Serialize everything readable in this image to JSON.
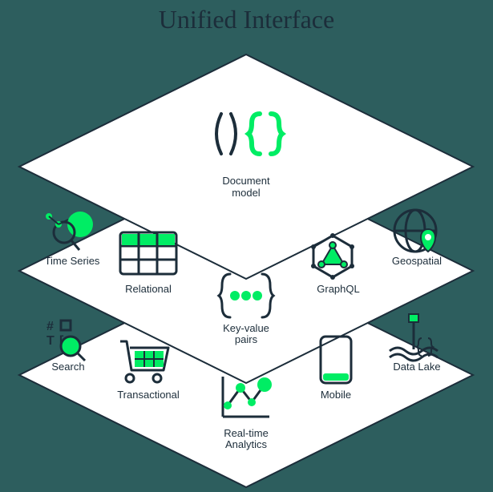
{
  "title": "Unified Interface",
  "layers": {
    "top": {
      "items": [
        {
          "label": "Document model",
          "icon": "document-model-icon"
        }
      ]
    },
    "middle": {
      "items": [
        {
          "label": "Time Series",
          "icon": "time-series-icon"
        },
        {
          "label": "Relational",
          "icon": "relational-icon"
        },
        {
          "label": "Key-value pairs",
          "icon": "key-value-icon"
        },
        {
          "label": "GraphQL",
          "icon": "graphql-icon"
        },
        {
          "label": "Geospatial",
          "icon": "geospatial-icon"
        }
      ]
    },
    "bottom": {
      "items": [
        {
          "label": "Search",
          "icon": "search-icon"
        },
        {
          "label": "Transactional",
          "icon": "transactional-icon"
        },
        {
          "label": "Real-time Analytics",
          "icon": "analytics-icon"
        },
        {
          "label": "Mobile",
          "icon": "mobile-icon"
        },
        {
          "label": "Data Lake",
          "icon": "data-lake-icon"
        }
      ]
    }
  },
  "colors": {
    "accent": "#00ED64",
    "dark": "#1c2d3a",
    "bg": "#2d5e5e"
  }
}
